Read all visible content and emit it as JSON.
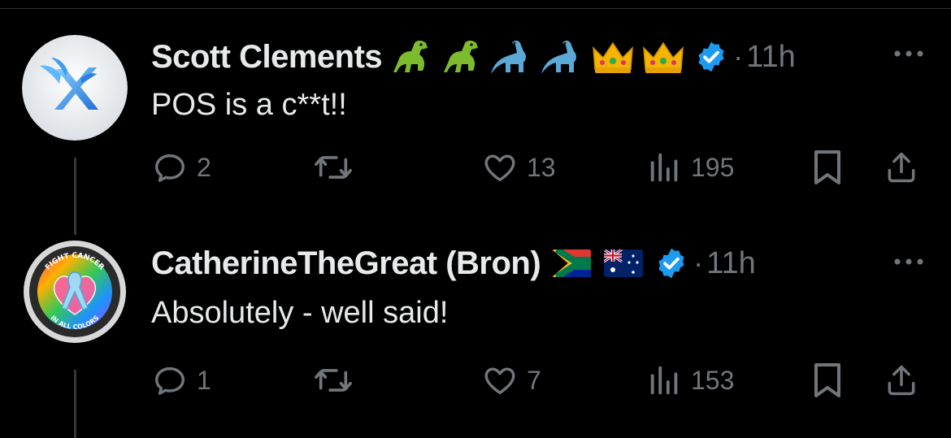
{
  "tweets": [
    {
      "author": "Scott Clements",
      "emojis": [
        "t-rex-emoji",
        "t-rex-emoji",
        "sauropod-emoji",
        "sauropod-emoji",
        "crown-emoji",
        "crown-emoji"
      ],
      "separator": "·",
      "time": "11h",
      "text": "POS is a c**t!!",
      "replies": "2",
      "reposts": "",
      "likes": "13",
      "views": "195"
    },
    {
      "author": "CatherineTheGreat (Bron)",
      "emojis": [
        "south-africa-flag-emoji",
        "australia-flag-emoji"
      ],
      "separator": "·",
      "time": "11h",
      "text": "Absolutely - well said!",
      "replies": "1",
      "reposts": "",
      "likes": "7",
      "views": "153"
    }
  ],
  "avatar_logos": {
    "t2_top": "FIGHT CANCER",
    "t2_bottom": "IN ALL COLORS"
  },
  "colors": {
    "background": "#000000",
    "text": "#e7e9ea",
    "secondary": "#71767b",
    "verified": "#1d9bf0"
  }
}
